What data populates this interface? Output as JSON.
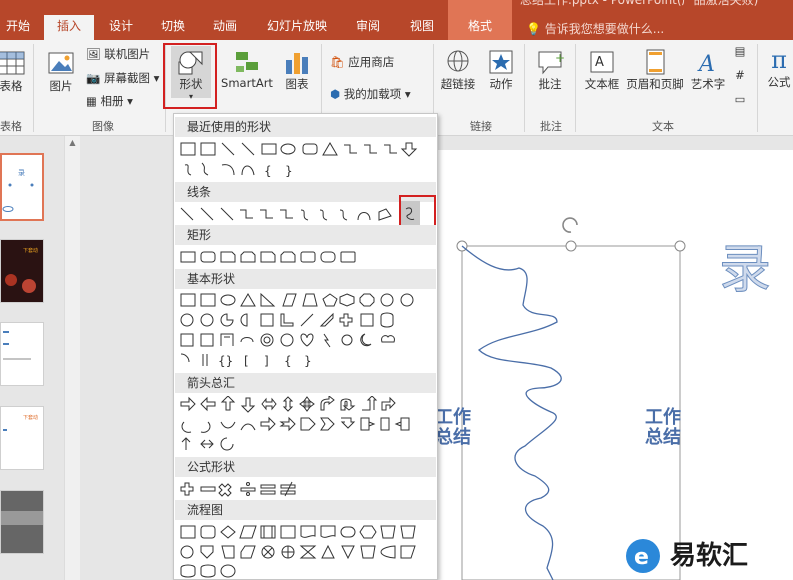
{
  "window": {
    "title": "总结工作.pptx - PowerPoint(产品激活失败)",
    "tabs": [
      "开始",
      "插入",
      "设计",
      "切换",
      "动画",
      "幻灯片放映",
      "审阅",
      "视图"
    ],
    "context_tab": "格式",
    "active_tab": "插入",
    "tell_me": "告诉我您想要做什么..."
  },
  "ribbon": {
    "groups": {
      "table": "表格",
      "images": "图像",
      "links": "链接",
      "comments": "批注",
      "text": "文本"
    },
    "buttons": {
      "table": "表格",
      "picture": "图片",
      "online_picture": "联机图片",
      "screenshot": "屏幕截图",
      "album": "相册",
      "shapes": "形状",
      "smartart": "SmartArt",
      "chart": "图表",
      "store": "应用商店",
      "my_addins": "我的加载项",
      "hyperlink": "超链接",
      "action": "动作",
      "comment": "批注",
      "textbox": "文本框",
      "header_footer": "页眉和页脚",
      "wordart": "艺术字",
      "equation": "公式"
    }
  },
  "shapes_menu": {
    "sections": [
      "最近使用的形状",
      "线条",
      "矩形",
      "基本形状",
      "箭头总汇",
      "公式形状",
      "流程图"
    ]
  },
  "slide": {
    "big_char": "录",
    "left_text_line1": "工作",
    "left_text_line2": "总结",
    "right_text_line1": "工作",
    "right_text_line2": "总结"
  },
  "watermark": {
    "text": "易软汇"
  },
  "colors": {
    "brand": "#b7472a",
    "highlight": "#d32020"
  }
}
